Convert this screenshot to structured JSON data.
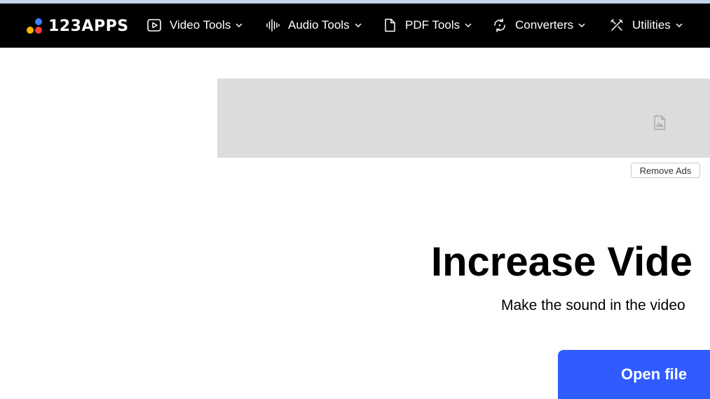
{
  "app": {
    "logo_text": "123APPS",
    "logo_dot_colors": [
      "#ffb400",
      "#ff3b3b",
      "#3f7cff"
    ]
  },
  "nav": {
    "items": [
      {
        "label": "Video Tools",
        "icon": "play-square-icon"
      },
      {
        "label": "Audio Tools",
        "icon": "audio-wave-icon"
      },
      {
        "label": "PDF Tools",
        "icon": "document-icon"
      },
      {
        "label": "Converters",
        "icon": "convert-cycle-icon"
      },
      {
        "label": "Utilities",
        "icon": "tools-icon"
      }
    ]
  },
  "ad": {
    "icon": "broken-image-icon",
    "remove_label": "Remove Ads"
  },
  "main": {
    "title": "Increase Vide",
    "subtitle": "Make the sound in the video",
    "open_file_label": "Open file"
  },
  "colors": {
    "navbar_bg": "#000000",
    "top_strip": "#c6d4ec",
    "ad_bg": "#dcdcdc",
    "primary_button": "#2f5bff"
  }
}
